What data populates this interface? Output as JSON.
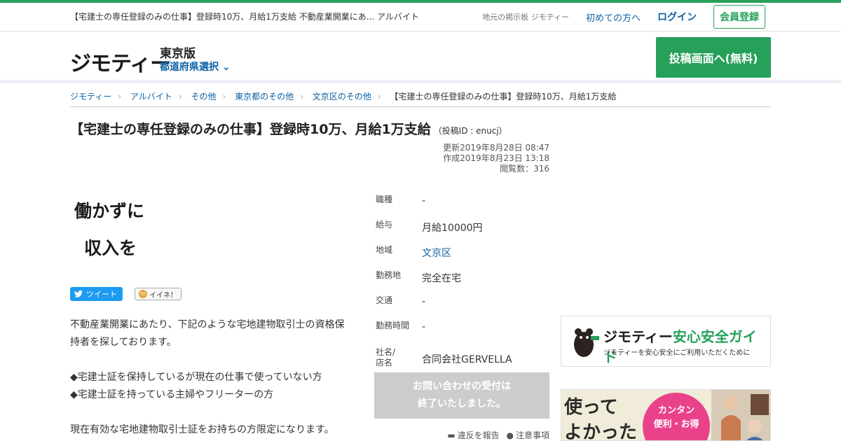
{
  "header": {
    "page_title": "【宅建士の専任登録のみの仕事】登録時10万、月給1万支給 不動産業開業にあ... アルバイト",
    "tagline": "地元の掲示板 ジモティー",
    "first_time": "初めての方へ",
    "login": "ログイン",
    "register": "会員登録"
  },
  "site": {
    "logo_text": "ジモティー",
    "region": "東京版",
    "pref_select": "都道府県選択",
    "post_button": "投稿画面へ(無料)"
  },
  "breadcrumb": [
    "ジモティー",
    "アルバイト",
    "その他",
    "東京都のその他",
    "文京区のその他",
    "【宅建士の専任登録のみの仕事】登録時10万、月給1万支給"
  ],
  "post": {
    "title": "【宅建士の専任登録のみの仕事】登録時10万、月給1万支給",
    "post_id": "（投稿ID : enucj）",
    "updated": "更新2019年8月28日 08:47",
    "created": "作成2019年8月23日 13:18",
    "views": "閲覧数：316",
    "image_line1": "働かずに",
    "image_line2": "収入を",
    "tweet": "ツイート",
    "iine": "イイネ！",
    "body": [
      "不動産業開業にあたり、下記のような宅地建物取引士の資格保持者を探しております。",
      "◆宅建士証を保持しているが現在の仕事で使っていない方",
      "◆宅建士証を持っている主婦やフリーターの方",
      "現在有効な宅地建物取引士証をお持ちの方限定になります。"
    ]
  },
  "details": {
    "job_type_label": "職種",
    "job_type": "-",
    "salary_label": "給与",
    "salary": "月給10000円",
    "area_label": "地域",
    "area": "文京区",
    "workplace_label": "勤務地",
    "workplace": "完全在宅",
    "transport_label": "交通",
    "transport": "-",
    "hours_label": "勤務時間",
    "hours": "-",
    "company_label_1": "社名/",
    "company_label_2": "店名",
    "company": "合同会社GERVELLA"
  },
  "contact": {
    "line1": "お問い合わせの受付は",
    "line2": "終了いたしました。"
  },
  "report": {
    "violation": "違反を報告",
    "notice": "注意事項"
  },
  "side": {
    "guide_title_brand": "ジモティー",
    "guide_title": "安心安全ガイド",
    "guide_sub": "ジモティーを安心安全にご利用いただくために",
    "banner_line1": "使って",
    "banner_line2": "よかった",
    "banner_badge1": "カンタン",
    "banner_badge2": "便利・お得"
  },
  "colors": {
    "brand_green": "#27a05a",
    "link_blue": "#0b61a4",
    "disabled_gray": "#cccccc"
  }
}
